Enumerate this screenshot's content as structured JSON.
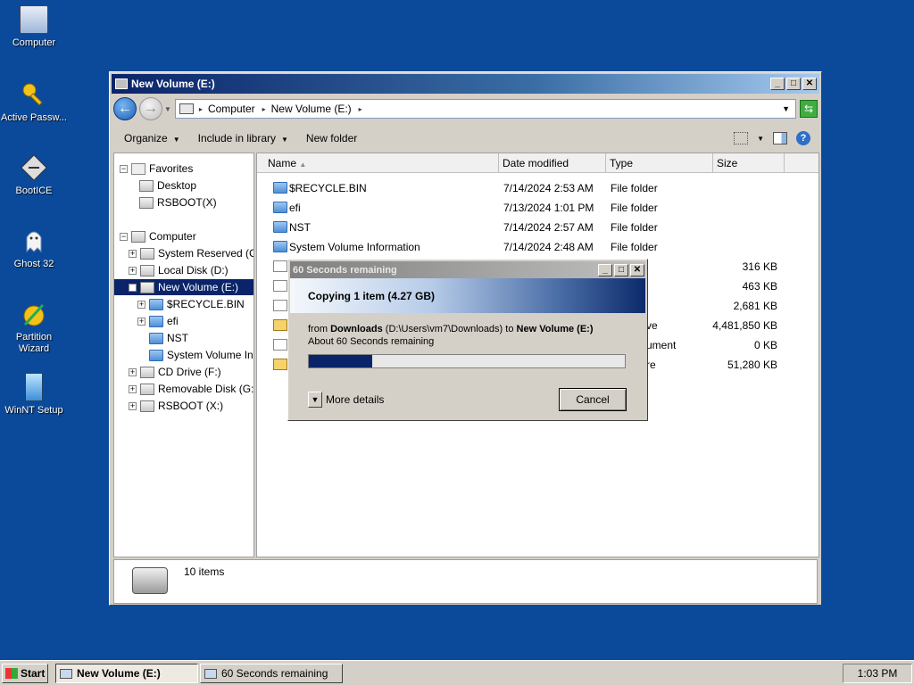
{
  "desktop": {
    "icons": [
      {
        "label": "Computer"
      },
      {
        "label": "Active Passw..."
      },
      {
        "label": "BootICE"
      },
      {
        "label": "Ghost 32"
      },
      {
        "label": "Partition Wizard"
      },
      {
        "label": "WinNT Setup"
      }
    ]
  },
  "window": {
    "title": "New Volume (E:)",
    "address": {
      "segments": [
        "Computer",
        "New Volume (E:)"
      ]
    },
    "toolbar": {
      "organize": "Organize",
      "include": "Include in library",
      "new_folder": "New folder",
      "help": "?"
    },
    "tree": [
      {
        "label": "Favorites"
      },
      {
        "label": "Desktop"
      },
      {
        "label": "RSBOOT(X)"
      },
      {
        "label": "Computer"
      },
      {
        "label": "System Reserved (C:)"
      },
      {
        "label": "Local Disk (D:)"
      },
      {
        "label": "New Volume (E:)"
      },
      {
        "label": "$RECYCLE.BIN"
      },
      {
        "label": "efi"
      },
      {
        "label": "NST"
      },
      {
        "label": "System Volume Information"
      },
      {
        "label": "CD Drive (F:)"
      },
      {
        "label": "Removable Disk (G:)"
      },
      {
        "label": "RSBOOT (X:)"
      }
    ],
    "columns": {
      "name": "Name",
      "date": "Date modified",
      "type": "Type",
      "size": "Size"
    },
    "files": [
      {
        "name": "$RECYCLE.BIN",
        "date": "7/14/2024 2:53 AM",
        "type": "File folder",
        "size": ""
      },
      {
        "name": "efi",
        "date": "7/13/2024 1:01 PM",
        "type": "File folder",
        "size": ""
      },
      {
        "name": "NST",
        "date": "7/14/2024 2:57 AM",
        "type": "File folder",
        "size": ""
      },
      {
        "name": "System Volume Information",
        "date": "7/14/2024 2:48 AM",
        "type": "File folder",
        "size": ""
      },
      {
        "name": "",
        "date": "",
        "type": "",
        "size": "316 KB"
      },
      {
        "name": "",
        "date": "",
        "type": "",
        "size": "463 KB"
      },
      {
        "name": "",
        "date": "",
        "type": "",
        "size": "2,681 KB"
      },
      {
        "name": "",
        "date": "",
        "type": "ve",
        "size": "4,481,850 KB"
      },
      {
        "name": "",
        "date": "",
        "type": "ument",
        "size": "0 KB"
      },
      {
        "name": "",
        "date": "",
        "type": "re",
        "size": "51,280 KB"
      }
    ],
    "status": {
      "count": "10 items"
    }
  },
  "dialog": {
    "title": "60 Seconds remaining",
    "heading": "Copying 1 item (4.27 GB)",
    "from_prefix": "from",
    "from_name": "Downloads",
    "from_path": "(D:\\Users\\vm7\\Downloads)",
    "to_word": "to",
    "to_name": "New Volume (E:)",
    "remaining": "About 60 Seconds remaining",
    "progress_fraction": 0.2,
    "more_details": "More details",
    "cancel": "Cancel"
  },
  "taskbar": {
    "start": "Start",
    "tasks": [
      {
        "label": "New Volume (E:)"
      },
      {
        "label": "60 Seconds remaining"
      }
    ],
    "clock": "1:03 PM"
  }
}
